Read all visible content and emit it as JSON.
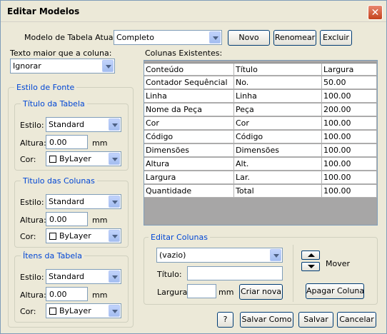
{
  "window": {
    "title": "Editar Modelos"
  },
  "model": {
    "label": "Modelo de Tabela Atual:",
    "value": "Completo"
  },
  "buttons": {
    "novo": "Novo",
    "renomear": "Renomear",
    "excluir": "Excluir",
    "help": "?",
    "salvar_como": "Salvar Como",
    "salvar": "Salvar",
    "cancelar": "Cancelar",
    "criar_nova": "Criar nova",
    "apagar_coluna": "Apagar Coluna"
  },
  "texto_maior": {
    "label": "Texto maior que a coluna:",
    "value": "Ignorar"
  },
  "estilo_fonte": {
    "label": "Estilo de Fonte",
    "sections": [
      {
        "title": "Título da Tabela",
        "estilo_label": "Estilo:",
        "estilo": "Standard",
        "altura_label": "Altura:",
        "altura": "0.00",
        "unit": "mm",
        "cor_label": "Cor:",
        "cor": "ByLayer"
      },
      {
        "title": "Titulo das Colunas",
        "estilo_label": "Estilo:",
        "estilo": "Standard",
        "altura_label": "Altura:",
        "altura": "0.00",
        "unit": "mm",
        "cor_label": "Cor:",
        "cor": "ByLayer"
      },
      {
        "title": "Ítens da Tabela",
        "estilo_label": "Estilo:",
        "estilo": "Standard",
        "altura_label": "Altura:",
        "altura": "0.00",
        "unit": "mm",
        "cor_label": "Cor:",
        "cor": "ByLayer"
      }
    ]
  },
  "colunas": {
    "label": "Colunas Existentes:",
    "headers": [
      "Conteúdo",
      "Título",
      "Largura"
    ],
    "rows": [
      [
        "Contador Sequêncial",
        "No.",
        "50.00"
      ],
      [
        "Linha",
        "Linha",
        "100.00"
      ],
      [
        "Nome da Peça",
        "Peça",
        "200.00"
      ],
      [
        "Cor",
        "Cor",
        "100.00"
      ],
      [
        "Código",
        "Código",
        "100.00"
      ],
      [
        "Dimensões",
        "Dimensões",
        "100.00"
      ],
      [
        "Altura",
        "Alt.",
        "100.00"
      ],
      [
        "Largura",
        "Lar.",
        "100.00"
      ],
      [
        "Quantidade",
        "Total",
        "100.00"
      ]
    ]
  },
  "editar": {
    "label": "Editar Colunas",
    "conteudo": "(vazio)",
    "titulo_label": "Título:",
    "titulo": "",
    "largura_label": "Largura:",
    "largura": "",
    "unit": "mm",
    "mover": "Mover"
  }
}
